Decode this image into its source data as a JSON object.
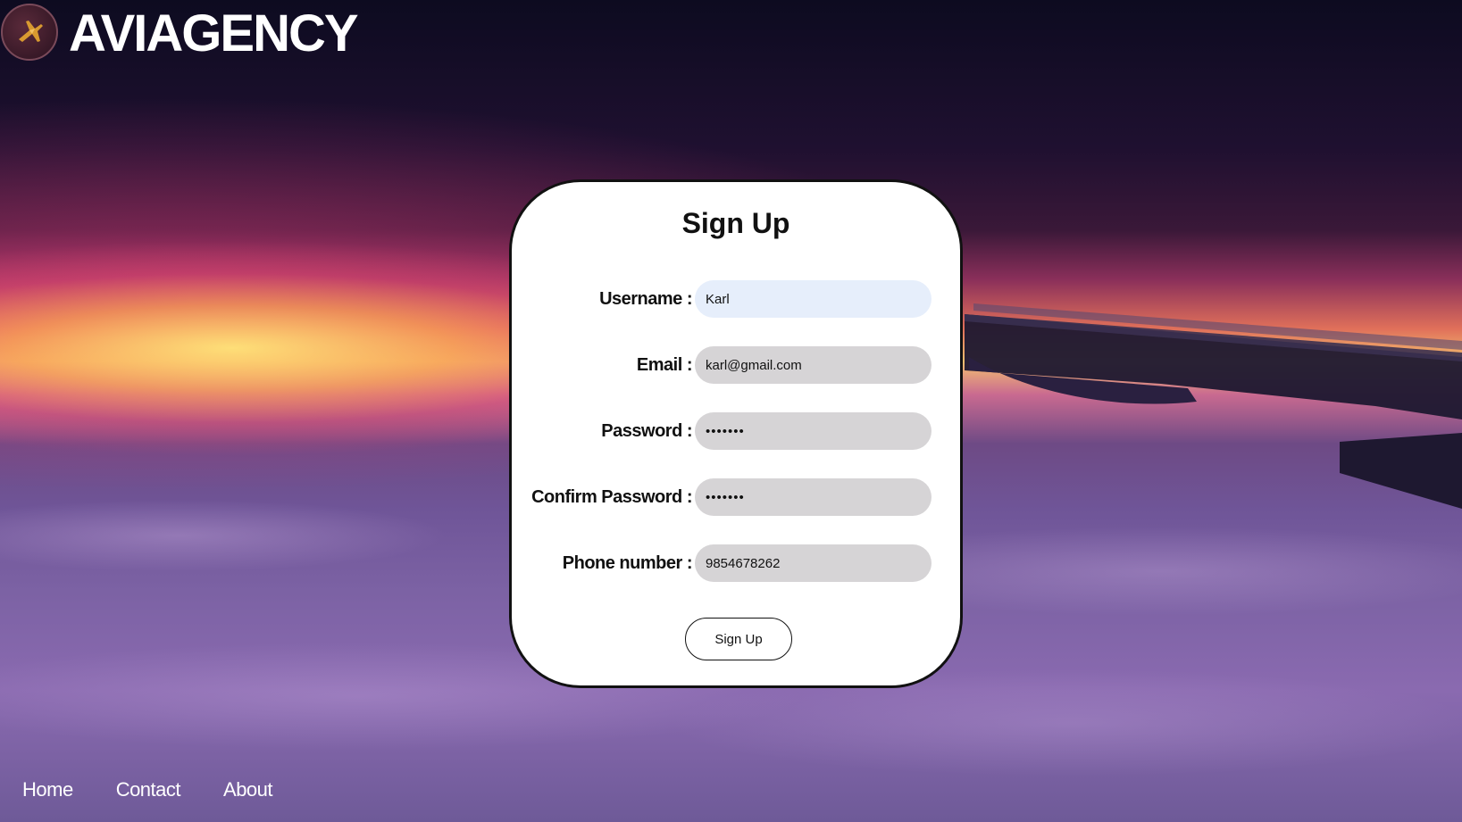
{
  "brand": {
    "name": "AVIAGENCY",
    "logo_icon": "plane-logo-icon"
  },
  "form": {
    "title": "Sign Up",
    "fields": [
      {
        "label": "Username :",
        "value": "Karl",
        "type": "text",
        "focused": true
      },
      {
        "label": "Email :",
        "value": "karl@gmail.com",
        "type": "text",
        "focused": false
      },
      {
        "label": "Password :",
        "value": "•••••••",
        "type": "password",
        "focused": false
      },
      {
        "label": "Confirm Password :",
        "value": "•••••••",
        "type": "password",
        "focused": false
      },
      {
        "label": "Phone number :",
        "value": "9854678262",
        "type": "text",
        "focused": false
      }
    ],
    "submit_label": "Sign Up"
  },
  "nav": {
    "items": [
      "Home",
      "Contact",
      "About"
    ]
  },
  "colors": {
    "card_bg": "#ffffff",
    "field_bg": "#d6d4d6",
    "field_focused_bg": "#e6eefb",
    "text": "#111111",
    "nav_text": "#ffffff"
  }
}
